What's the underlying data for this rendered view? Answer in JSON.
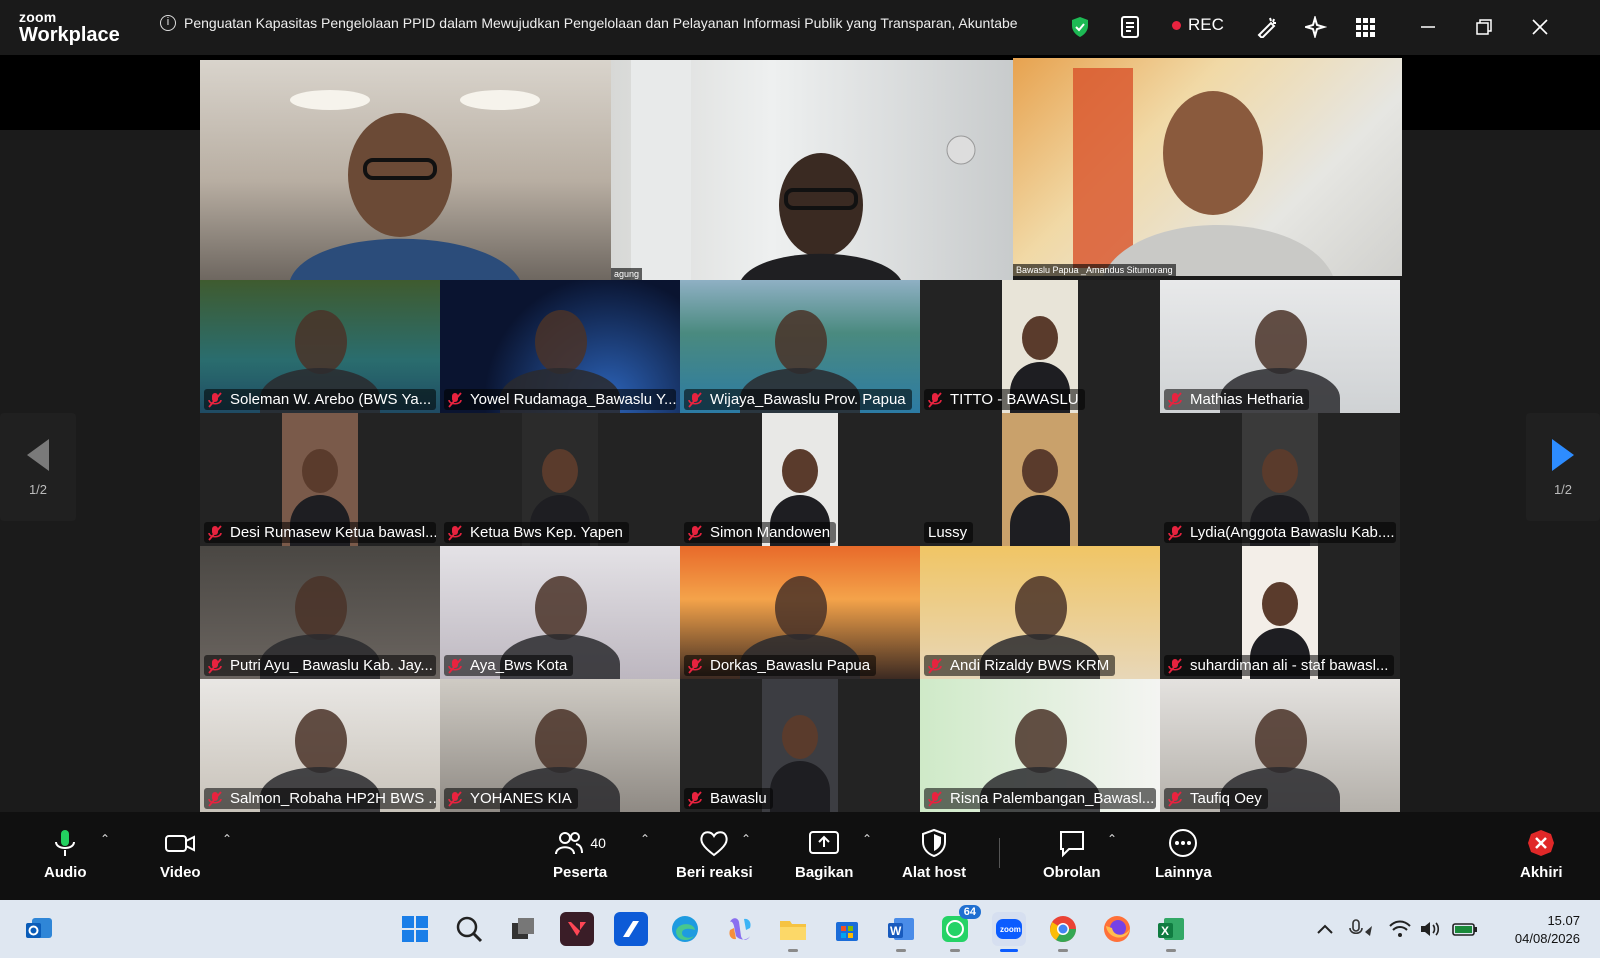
{
  "window": {
    "brand_small": "zoom",
    "brand_large": "Workplace",
    "meeting_title": "Penguatan Kapasitas Pengelolaan PPID dalam Mewujudkan Pengelolaan dan Pelayanan Informasi Publik yang Transparan, Akuntabe",
    "rec_label": "REC"
  },
  "top_tiles": [
    {
      "label": ""
    },
    {
      "label": "agung"
    },
    {
      "label": "Bawaslu Papua _Amandus Situmorang"
    }
  ],
  "participants": [
    {
      "name": "Soleman W. Arebo (BWS Ya...",
      "muted": true
    },
    {
      "name": "Yowel Rudamaga_Bawaslu Y...",
      "muted": true
    },
    {
      "name": "Wijaya_Bawaslu Prov. Papua",
      "muted": true
    },
    {
      "name": "TITTO - BAWASLU",
      "muted": true
    },
    {
      "name": "Mathias Hetharia",
      "muted": true
    },
    {
      "name": "Desi Rumasew Ketua bawasl...",
      "muted": true
    },
    {
      "name": "Ketua Bws Kep. Yapen",
      "muted": true
    },
    {
      "name": "Simon Mandowen",
      "muted": true
    },
    {
      "name": "Lussy",
      "muted": false
    },
    {
      "name": "Lydia(Anggota Bawaslu Kab....",
      "muted": true
    },
    {
      "name": "Putri Ayu_ Bawaslu Kab. Jay...",
      "muted": true
    },
    {
      "name": "Aya_Bws Kota",
      "muted": true
    },
    {
      "name": "Dorkas_Bawaslu Papua",
      "muted": true
    },
    {
      "name": "Andi Rizaldy BWS KRM",
      "muted": true
    },
    {
      "name": "suhardiman ali - staf bawasl...",
      "muted": true
    },
    {
      "name": "Salmon_Robaha HP2H BWS ...",
      "muted": true
    },
    {
      "name": "YOHANES KIA",
      "muted": true
    },
    {
      "name": "Bawaslu",
      "muted": true
    },
    {
      "name": "Risna Palembangan_Bawasl...",
      "muted": true
    },
    {
      "name": "Taufiq Oey",
      "muted": true
    }
  ],
  "pager": {
    "left": "1/2",
    "right": "1/2"
  },
  "toolbar": {
    "audio": "Audio",
    "video": "Video",
    "participants": "Peserta",
    "participant_count": "40",
    "react": "Beri reaksi",
    "share": "Bagikan",
    "host_tools": "Alat host",
    "chat": "Obrolan",
    "more": "Lainnya",
    "end": "Akhiri"
  },
  "taskbar": {
    "whatsapp_badge": "64",
    "time": "15.07",
    "date": "04/08/2026"
  },
  "colors": {
    "accent_blue": "#0b5cff",
    "rec_red": "#e8233f",
    "shield_green": "#1db954",
    "end_red": "#e02828"
  }
}
